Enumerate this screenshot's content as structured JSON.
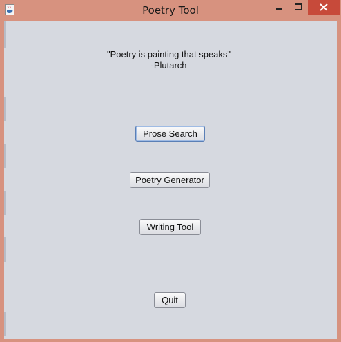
{
  "window": {
    "title": "Poetry Tool",
    "icon": "java-cup-icon"
  },
  "quote": {
    "text": "\"Poetry is painting that speaks\"",
    "author": "-Plutarch"
  },
  "buttons": {
    "prose_search": "Prose Search",
    "poetry_generator": "Poetry Generator",
    "writing_tool": "Writing Tool",
    "quit": "Quit"
  },
  "colors": {
    "frame": "#d7927f",
    "close": "#c74a3a",
    "client": "#d6d9e0"
  }
}
